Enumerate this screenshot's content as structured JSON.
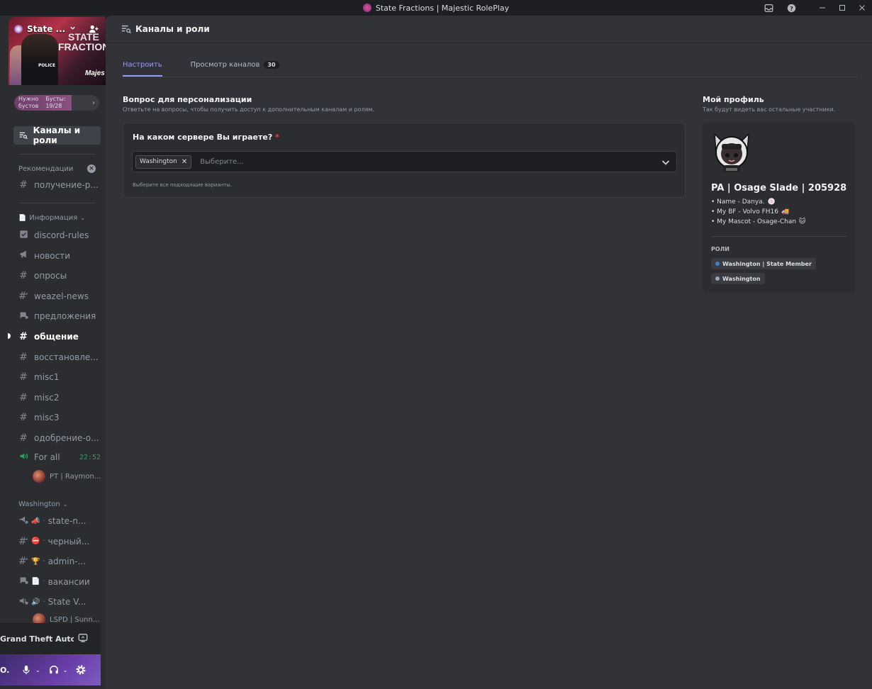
{
  "window": {
    "title": "State Fractions | Majestic RolePlay"
  },
  "server": {
    "name": "State ...",
    "banner_line1": "STATE",
    "banner_line2": "FRACTION",
    "banner_brand": "Majes",
    "banner_badge": "POLICE",
    "boost": {
      "needed_label": "Нужно\nбустов",
      "boosts_label": "Бусты:\n19/28",
      "current": 19,
      "goal": 28
    }
  },
  "sidebar": {
    "active_item": "Каналы и роли",
    "categories": {
      "recommendations": "Рекомендации",
      "info": "Информация",
      "washington": "Washington"
    },
    "recommendation_channel": "получение-р...",
    "info_channels": [
      {
        "name": "discord-rules",
        "icon": "rules-icon"
      },
      {
        "name": "новости",
        "icon": "announcement-icon"
      },
      {
        "name": "опросы",
        "icon": "hash-icon"
      },
      {
        "name": "weazel-news",
        "icon": "hash-thread-icon"
      },
      {
        "name": "предложения",
        "icon": "forum-icon"
      },
      {
        "name": "общение",
        "icon": "hash-icon"
      },
      {
        "name": "восстановле...",
        "icon": "hash-icon"
      },
      {
        "name": "misc1",
        "icon": "hash-icon"
      },
      {
        "name": "misc2",
        "icon": "hash-icon"
      },
      {
        "name": "misc3",
        "icon": "hash-icon"
      },
      {
        "name": "одобрение-о...",
        "icon": "hash-icon"
      }
    ],
    "voice_channel": {
      "name": "For all",
      "time": "22:52",
      "user": "PT | Raymon..."
    },
    "washington_channels": [
      {
        "name": "state-n...",
        "emoji": "📣",
        "icon": "announcement-thread-icon"
      },
      {
        "name": "черный...",
        "emoji": "⛔",
        "icon": "hash-thread-icon"
      },
      {
        "name": "admin-...",
        "emoji": "🏆",
        "icon": "hash-thread-icon"
      },
      {
        "name": "вакансии",
        "emoji": "📄",
        "icon": "forum-icon"
      },
      {
        "name": "State V...",
        "emoji": "🔊",
        "icon": "voice-thread-icon"
      }
    ],
    "washington_voice_user": "LSPD | Sunn..."
  },
  "activity": {
    "text": "Grand Theft Auto ..."
  },
  "user_panel": {
    "name": "O."
  },
  "main": {
    "header_title": "Каналы и роли",
    "tabs": [
      {
        "label": "Настроить",
        "active": true
      },
      {
        "label": "Просмотр каналов",
        "count": "30"
      }
    ],
    "personalization": {
      "title": "Вопрос для персонализации",
      "subtitle": "Ответьте на вопросы, чтобы получить доступ к дополнительным каналам и ролям.",
      "question": "На каком сервере Вы играете?",
      "required_mark": "*",
      "selected_option": "Washington",
      "placeholder": "Выберите...",
      "hint": "Выберите все подходящие варианты."
    },
    "profile": {
      "title": "Мой профиль",
      "subtitle": "Так будут видеть вас остальные участники.",
      "display_name": "PA | Osage Slade | 205928",
      "bio_lines": [
        "• Name - Danya.",
        "• My BF - Volvo FH16",
        "• My Mascot - Osage-Chan"
      ],
      "roles_title": "РОЛИ",
      "roles": [
        {
          "name": "Washington | State Member",
          "color": "#3b82c4"
        },
        {
          "name": "Washington",
          "color": "#99aab5"
        }
      ]
    }
  },
  "colors": {
    "accent": "#949cf7",
    "required": "#f23f43",
    "voice_green": "#23a55a"
  }
}
